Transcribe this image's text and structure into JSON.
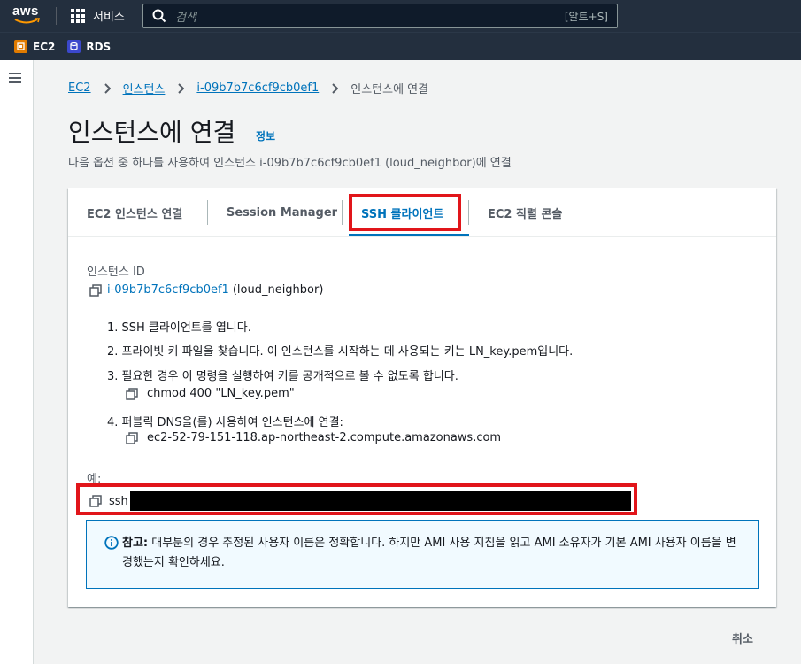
{
  "topbar": {
    "logo_text": "aws",
    "services_label": "서비스",
    "search_placeholder": "검색",
    "search_shortcut": "[알트+S]"
  },
  "favorites": [
    {
      "label": "EC2",
      "icon": "ec2-icon",
      "color": "#e07b00"
    },
    {
      "label": "RDS",
      "icon": "rds-icon",
      "color": "#3b48cc"
    }
  ],
  "breadcrumb": {
    "items": [
      "EC2",
      "인스턴스",
      "i-09b7b7c6cf9cb0ef1"
    ],
    "current": "인스턴스에 연결"
  },
  "page": {
    "title": "인스턴스에 연결",
    "info_link": "정보",
    "subtitle": "다음 옵션 중 하나를 사용하여 인스턴스 i-09b7b7c6cf9cb0ef1 (loud_neighbor)에 연결"
  },
  "tabs": [
    {
      "label": "EC2 인스턴스 연결",
      "active": false
    },
    {
      "label": "Session Manager",
      "active": false
    },
    {
      "label": "SSH 클라이언트",
      "active": true
    },
    {
      "label": "EC2 직렬 콘솔",
      "active": false
    }
  ],
  "ssh": {
    "instance_id_label": "인스턴스 ID",
    "instance_id": "i-09b7b7c6cf9cb0ef1",
    "instance_name": "(loud_neighbor)",
    "steps": [
      "1. SSH 클라이언트를 엽니다.",
      "2. 프라이빗 키 파일을 찾습니다. 이 인스턴스를 시작하는 데 사용되는 키는 LN_key.pem입니다.",
      "3. 필요한 경우 이 명령을 실행하여 키를 공개적으로 볼 수 없도록 합니다.",
      "4. 퍼블릭 DNS을(를) 사용하여 인스턴스에 연결:"
    ],
    "chmod_cmd": "chmod 400 \"LN_key.pem\"",
    "public_dns": "ec2-52-79-151-118.ap-northeast-2.compute.amazonaws.com",
    "example_label": "예:",
    "ssh_prefix": "ssh",
    "note_bold": "참고:",
    "note_text": " 대부분의 경우 추정된 사용자 이름은 정확합니다. 하지만 AMI 사용 지침을 읽고 AMI 소유자가 기본 AMI 사용자 이름을 변경했는지 확인하세요."
  },
  "footer": {
    "cancel_label": "취소"
  },
  "colors": {
    "nav_bg": "#232f3e",
    "link": "#0073bb",
    "highlight": "#e1151a"
  }
}
